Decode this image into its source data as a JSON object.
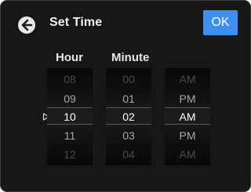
{
  "header": {
    "title": "Set Time",
    "ok_label": "OK",
    "back_icon": "back-arrow-icon"
  },
  "columns": {
    "hour_header": "Hour",
    "minute_header": "Minute"
  },
  "wheels": {
    "hour": [
      "08",
      "09",
      "10",
      "11",
      "12"
    ],
    "minute": [
      "00",
      "01",
      "02",
      "03",
      "04"
    ],
    "ampm": [
      "AM",
      "PM",
      "AM",
      "PM",
      "AM"
    ]
  },
  "selected": {
    "hour": "10",
    "minute": "02",
    "ampm": "AM"
  },
  "colors": {
    "accent": "#3f8ff0",
    "background": "#101010",
    "text": "#f2f2f2"
  }
}
